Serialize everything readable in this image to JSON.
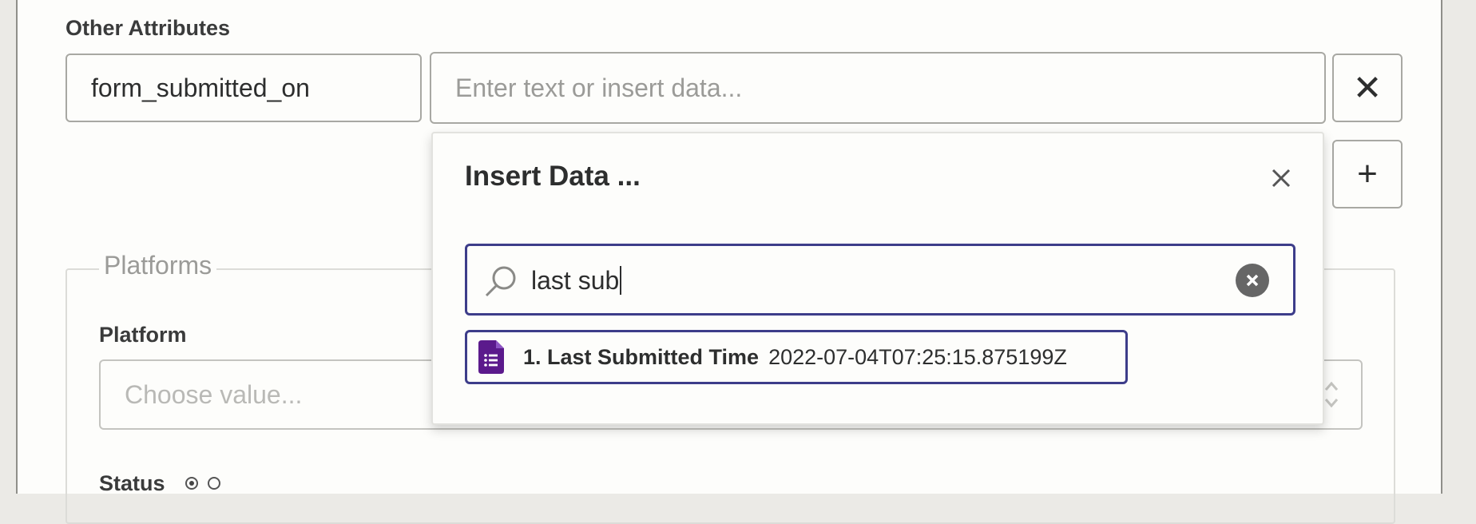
{
  "attributes": {
    "section_label": "Other Attributes",
    "key_value": "form_submitted_on",
    "value_placeholder": "Enter text or insert data...",
    "remove_symbol": "✕",
    "add_symbol": "+"
  },
  "platforms": {
    "legend": "Platforms",
    "platform_label": "Platform",
    "platform_placeholder": "Choose value...",
    "status_label": "Status"
  },
  "insert_data": {
    "title": "Insert Data ...",
    "search_value": "last sub",
    "results": [
      {
        "label": "1. Last Submitted Time",
        "value": "2022-07-04T07:25:15.875199Z",
        "icon": "google-forms-icon"
      }
    ]
  },
  "colors": {
    "accent": "#3d3d8a",
    "forms_purple": "#5b1a8c"
  }
}
